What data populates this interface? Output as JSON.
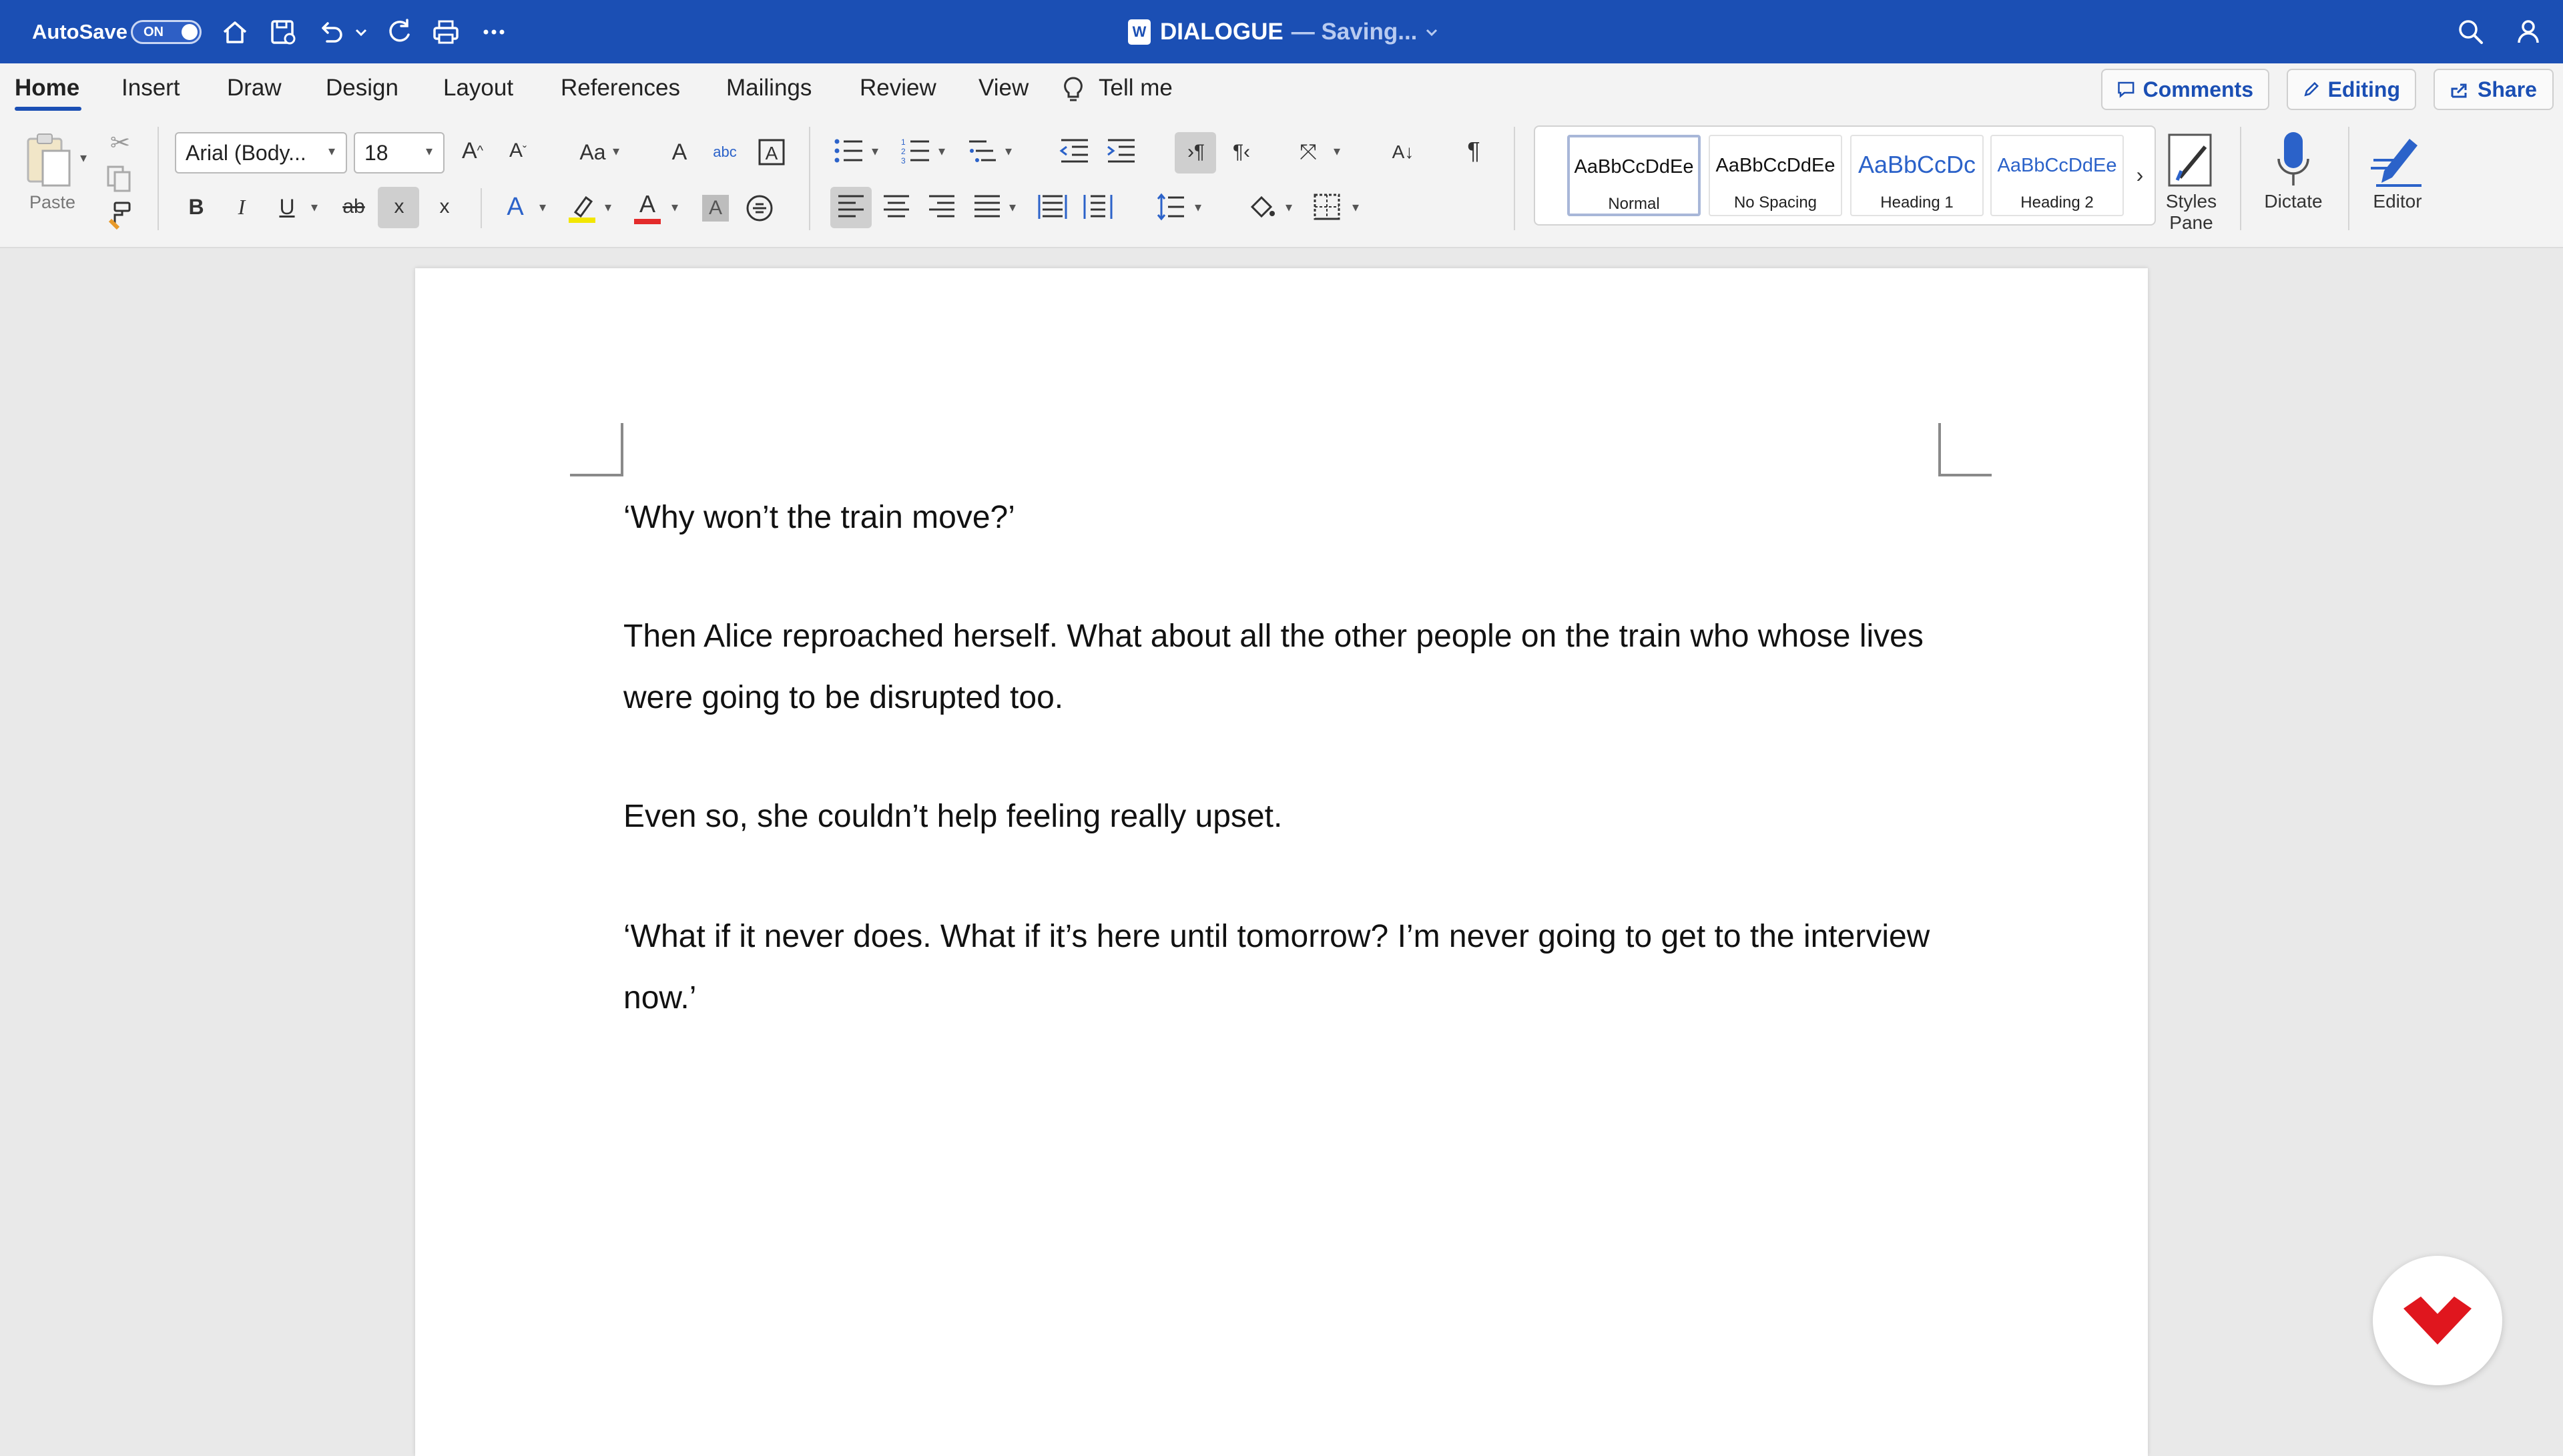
{
  "titlebar": {
    "autosave_label": "AutoSave",
    "autosave_state": "ON",
    "doc_badge": "W",
    "document_name": "DIALOGUE",
    "status": "— Saving..."
  },
  "tabs": [
    {
      "label": "Home"
    },
    {
      "label": "Insert"
    },
    {
      "label": "Draw"
    },
    {
      "label": "Design"
    },
    {
      "label": "Layout"
    },
    {
      "label": "References"
    },
    {
      "label": "Mailings"
    },
    {
      "label": "Review"
    },
    {
      "label": "View"
    },
    {
      "label": "Tell me"
    }
  ],
  "header_buttons": {
    "comments": "Comments",
    "editing": "Editing",
    "share": "Share"
  },
  "ribbon": {
    "paste_label": "Paste",
    "font_name": "Arial (Body...",
    "font_size": "18",
    "change_case": "Aa",
    "bold": "B",
    "italic": "I",
    "underline": "U",
    "strikethrough": "ab",
    "subscript": "x",
    "superscript": "x",
    "text_effects": "A",
    "font_color": "A",
    "char_shading": "A",
    "styles": [
      {
        "sample": "AaBbCcDdEe",
        "name": "Normal"
      },
      {
        "sample": "AaBbCcDdEe",
        "name": "No Spacing"
      },
      {
        "sample": "AaBbCcDc",
        "name": "Heading 1"
      },
      {
        "sample": "AaBbCcDdEe",
        "name": "Heading 2"
      }
    ],
    "styles_pane_label_1": "Styles",
    "styles_pane_label_2": "Pane",
    "dictate_label": "Dictate",
    "editor_label": "Editor"
  },
  "document": {
    "paragraphs": [
      "‘Why won’t the train move?’",
      "Then Alice reproached herself. What about all the other people on the train who whose lives were going to be disrupted too.",
      "Even so, she couldn’t help feeling really upset.",
      "‘What if it never does. What if it’s here until tomorrow? I’m never going to get to the interview now.’"
    ]
  },
  "colors": {
    "titlebar": "#1b4fb4",
    "accent": "#1b4fb4",
    "highlight": "#f2e600",
    "font_color": "#e32b2b"
  }
}
